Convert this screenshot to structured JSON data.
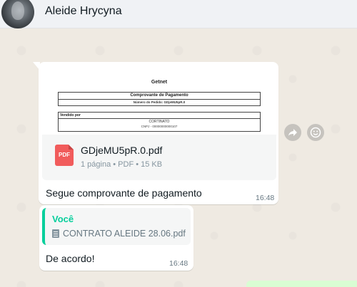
{
  "header": {
    "contact_name": "Aleide Hrycyna"
  },
  "messages": [
    {
      "document_preview": {
        "title": "Getnet",
        "box1_heading": "Comprovante de Pagamento",
        "box1_sub": "Número do Pedido: GDjeMU5pR.0",
        "box2_heading": "Vendido por",
        "box2_line1": "CORTINATO",
        "box2_line2": "CNPJ - 00000000000107"
      },
      "file": {
        "icon_label": "PDF",
        "name": "GDjeMU5pR.0.pdf",
        "meta": "1 página • PDF • 15 KB"
      },
      "text": "Segue comprovante de pagamento",
      "time": "16:48"
    },
    {
      "quote": {
        "author": "Você",
        "file_name": "CONTRATO ALEIDE 28.06.pdf"
      },
      "text": "De acordo!",
      "time": "16:48"
    }
  ],
  "colors": {
    "chat_background": "#efeae2",
    "accent_green": "#06cf9c",
    "pdf_red": "#f15c5c"
  },
  "icons": {
    "forward": "forward-icon",
    "emoji": "emoji-icon",
    "document": "document-icon"
  }
}
